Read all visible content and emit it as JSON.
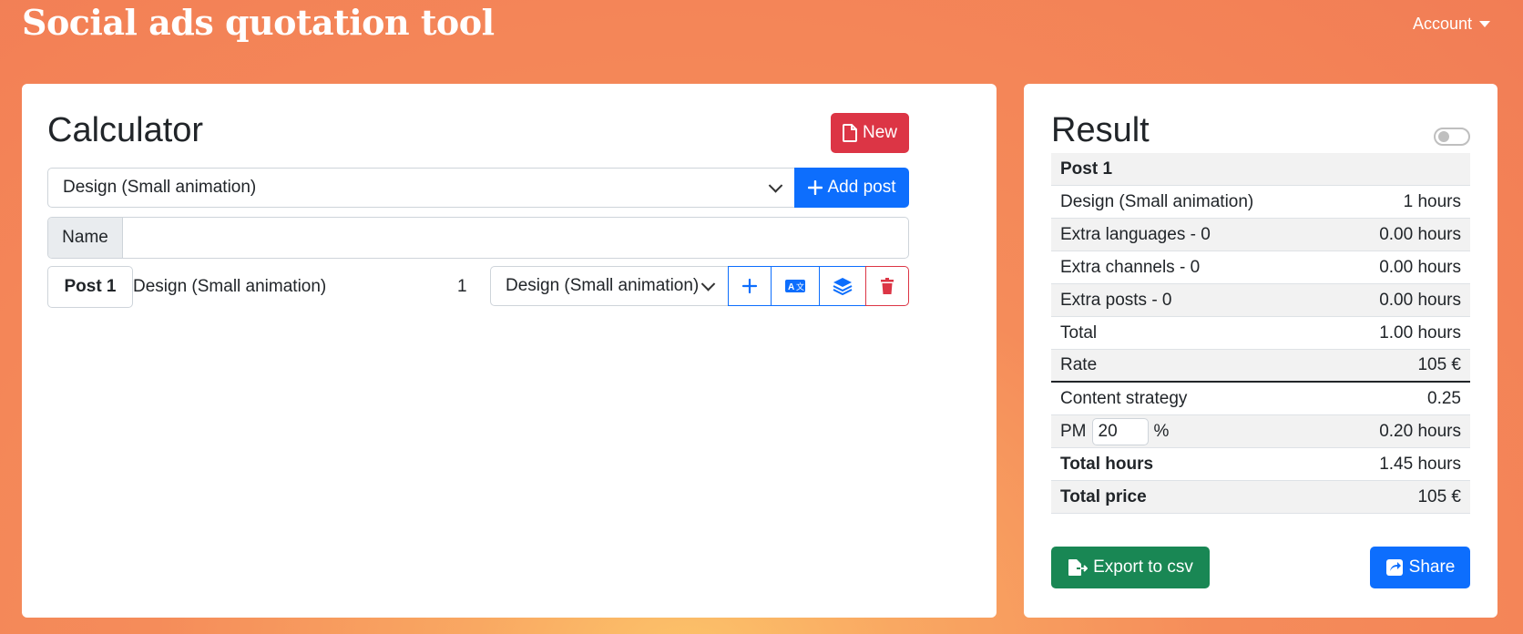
{
  "header": {
    "title": "Social ads quotation tool",
    "account_label": "Account"
  },
  "calculator": {
    "title": "Calculator",
    "new_label": "New",
    "post_type_select": "Design (Small animation)",
    "add_post_label": "Add post",
    "name_label": "Name",
    "name_value": "",
    "post": {
      "badge": "Post 1",
      "type": "Design (Small animation)",
      "quantity": "1",
      "select_value": "Design (Small animation)"
    }
  },
  "result": {
    "title": "Result",
    "rows": [
      {
        "label": "Post 1",
        "value": ""
      },
      {
        "label": "Design (Small animation)",
        "value": "1 hours"
      },
      {
        "label": "Extra languages - 0",
        "value": "0.00 hours"
      },
      {
        "label": "Extra channels - 0",
        "value": "0.00 hours"
      },
      {
        "label": "Extra posts - 0",
        "value": "0.00 hours"
      },
      {
        "label": "Total",
        "value": "1.00 hours"
      },
      {
        "label": "Rate",
        "value": "105 €"
      },
      {
        "label": "Content strategy",
        "value": "0.25"
      },
      {
        "label": "PM",
        "input_value": "20",
        "unit": "%",
        "value": "0.20 hours"
      },
      {
        "label": "Total hours",
        "value": "1.45 hours"
      },
      {
        "label": "Total price",
        "value": "105 €"
      }
    ],
    "export_label": "Export to csv",
    "share_label": "Share"
  },
  "colors": {
    "danger": "#dc3545",
    "primary": "#0d6efd",
    "success": "#198754"
  }
}
